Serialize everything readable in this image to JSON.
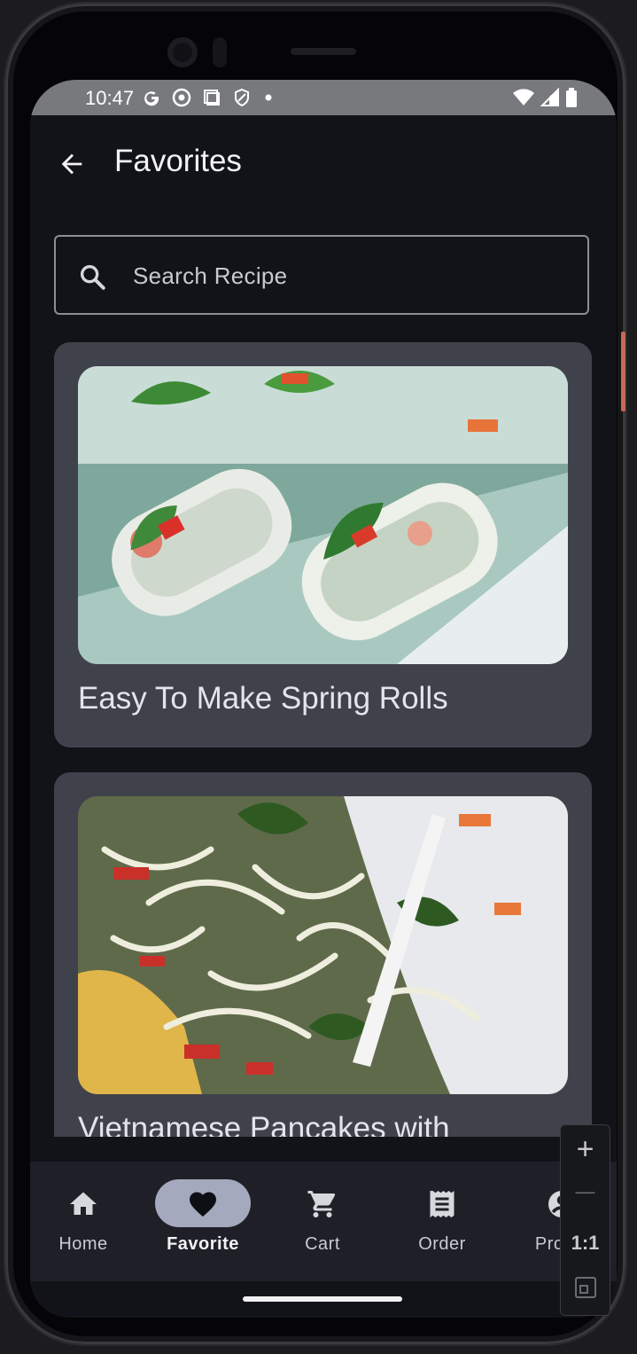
{
  "status_bar": {
    "time": "10:47",
    "left_icons": [
      "google-g-icon",
      "chrome-icon",
      "screenshot-icon",
      "shield-icon",
      "dot-icon"
    ],
    "right_icons": [
      "wifi-icon",
      "cellular-icon",
      "battery-icon"
    ]
  },
  "app_bar": {
    "title": "Favorites"
  },
  "search": {
    "placeholder": "Search Recipe"
  },
  "recipes": [
    {
      "title": "Easy To Make Spring Rolls",
      "image": "spring-rolls-photo"
    },
    {
      "title": "Vietnamese Pancakes with",
      "image": "vietnamese-pancakes-photo"
    }
  ],
  "bottom_nav": {
    "items": [
      {
        "label": "Home",
        "icon": "home-icon",
        "active": false
      },
      {
        "label": "Favorite",
        "icon": "heart-icon",
        "active": true
      },
      {
        "label": "Cart",
        "icon": "cart-icon",
        "active": false
      },
      {
        "label": "Order",
        "icon": "receipt-icon",
        "active": false
      },
      {
        "label": "Profile",
        "icon": "profile-icon",
        "active": false
      }
    ]
  },
  "zoom_controls": {
    "zoom_in": "+",
    "zoom_out": "—",
    "reset": "1:1"
  },
  "colors": {
    "background": "#111318",
    "card": "#40424b",
    "nav_bar": "#1f2027",
    "active_pill": "#a4a9bd"
  }
}
